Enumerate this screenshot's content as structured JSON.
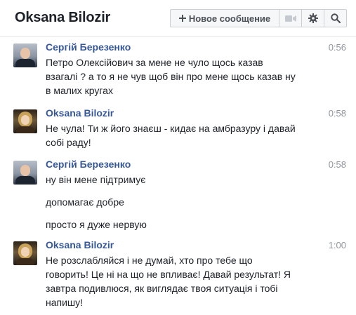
{
  "header": {
    "title": "Oksana Bilozir",
    "new_message_label": "Новое сообщение"
  },
  "icons": {
    "new_message": "plus-icon",
    "video": "video-camera-icon",
    "settings": "gear-icon",
    "search": "search-icon"
  },
  "colors": {
    "sender_name": "#365899",
    "text": "#1d2129",
    "timestamp": "#90949c"
  },
  "messages": [
    {
      "sender": "Сергій Березенко",
      "time": "0:56",
      "lines": [
        "Петро Олексійович за мене не чуло щось казав",
        "взагалі ? а то я не чув щоб він про мене щось казав ну",
        "в малих кругах"
      ]
    },
    {
      "sender": "Oksana Bilozir",
      "time": "0:58",
      "lines": [
        "Не чула! Ти ж його знаєш - кидає на амбразуру і давай",
        "собі раду!"
      ]
    },
    {
      "sender": "Сергій Березенко",
      "time": "0:58",
      "lines": [
        "ну він мене підтримує",
        "допомагає добре",
        "просто я дуже нервую"
      ]
    },
    {
      "sender": "Oksana Bilozir",
      "time": "1:00",
      "lines": [
        "Не розслабляйся і не думай, хто про тебе що",
        "говорить! Це ні на що не впливає! Давай результат! Я",
        "завтра подивлюся, як виглядає твоя ситуація і тобі",
        "напишу!"
      ]
    }
  ]
}
